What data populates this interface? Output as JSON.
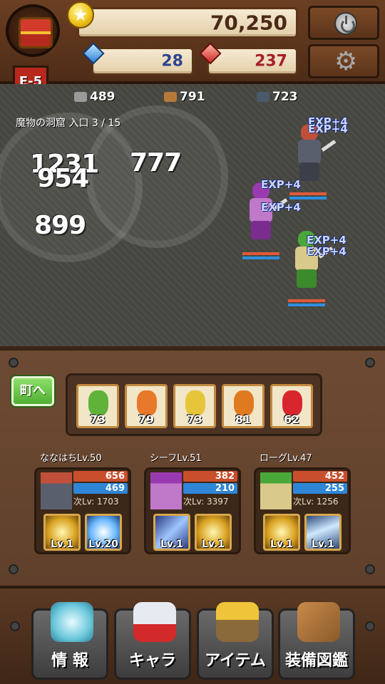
{
  "hud": {
    "gold": "70,250",
    "gems": "28",
    "rubies": "237",
    "stage": "E-5",
    "icons": [
      "treasure-chest-icon",
      "gold-coin-icon",
      "blue-gem-icon",
      "red-gem-icon",
      "power-icon",
      "gear-icon"
    ]
  },
  "resources": {
    "stone": "489",
    "wood": "791",
    "ore": "723"
  },
  "location": "魔物の洞窟 入口 3 / 15",
  "damage_numbers": [
    "1231",
    "954",
    "777",
    "899"
  ],
  "exp_popups": [
    "EXP+4",
    "EXP+4",
    "EXP+4",
    "EXP+4",
    "EXP+4",
    "EXP+4"
  ],
  "town_button": "町へ",
  "crops": [
    {
      "icon": "green-pepper-icon",
      "count": "73",
      "color": "#5fb33a"
    },
    {
      "icon": "carrot-icon",
      "count": "79",
      "color": "#e8782a"
    },
    {
      "icon": "corn-icon",
      "count": "73",
      "color": "#e7c53a"
    },
    {
      "icon": "pumpkin-icon",
      "count": "81",
      "color": "#e07a1f"
    },
    {
      "icon": "apple-icon",
      "count": "62",
      "color": "#d8262e"
    }
  ],
  "party": [
    {
      "name": "ななはちLv.50",
      "hp": "656",
      "mp": "469",
      "next": "次Lv: 1703",
      "skills": [
        {
          "icon": "burst-skill-icon",
          "lv": "Lv.1"
        },
        {
          "icon": "light-orb-skill-icon",
          "lv": "Lv.20"
        }
      ]
    },
    {
      "name": "シーフLv.51",
      "hp": "382",
      "mp": "210",
      "next": "次Lv: 3397",
      "skills": [
        {
          "icon": "sword-skill-icon",
          "lv": "Lv.1"
        },
        {
          "icon": "burst-skill-icon",
          "lv": "Lv.1"
        }
      ]
    },
    {
      "name": "ローグLv.47",
      "hp": "452",
      "mp": "255",
      "next": "次Lv: 1256",
      "skills": [
        {
          "icon": "burst-skill-icon",
          "lv": "Lv.1"
        },
        {
          "icon": "ice-skill-icon",
          "lv": "Lv.1"
        }
      ]
    }
  ],
  "nav": [
    {
      "label": "情 報",
      "icon": "info-emblem-icon"
    },
    {
      "label": "キャラ",
      "icon": "helmet-icon"
    },
    {
      "label": "アイテム",
      "icon": "item-chest-icon"
    },
    {
      "label": "装備図鑑",
      "icon": "book-icon"
    }
  ]
}
